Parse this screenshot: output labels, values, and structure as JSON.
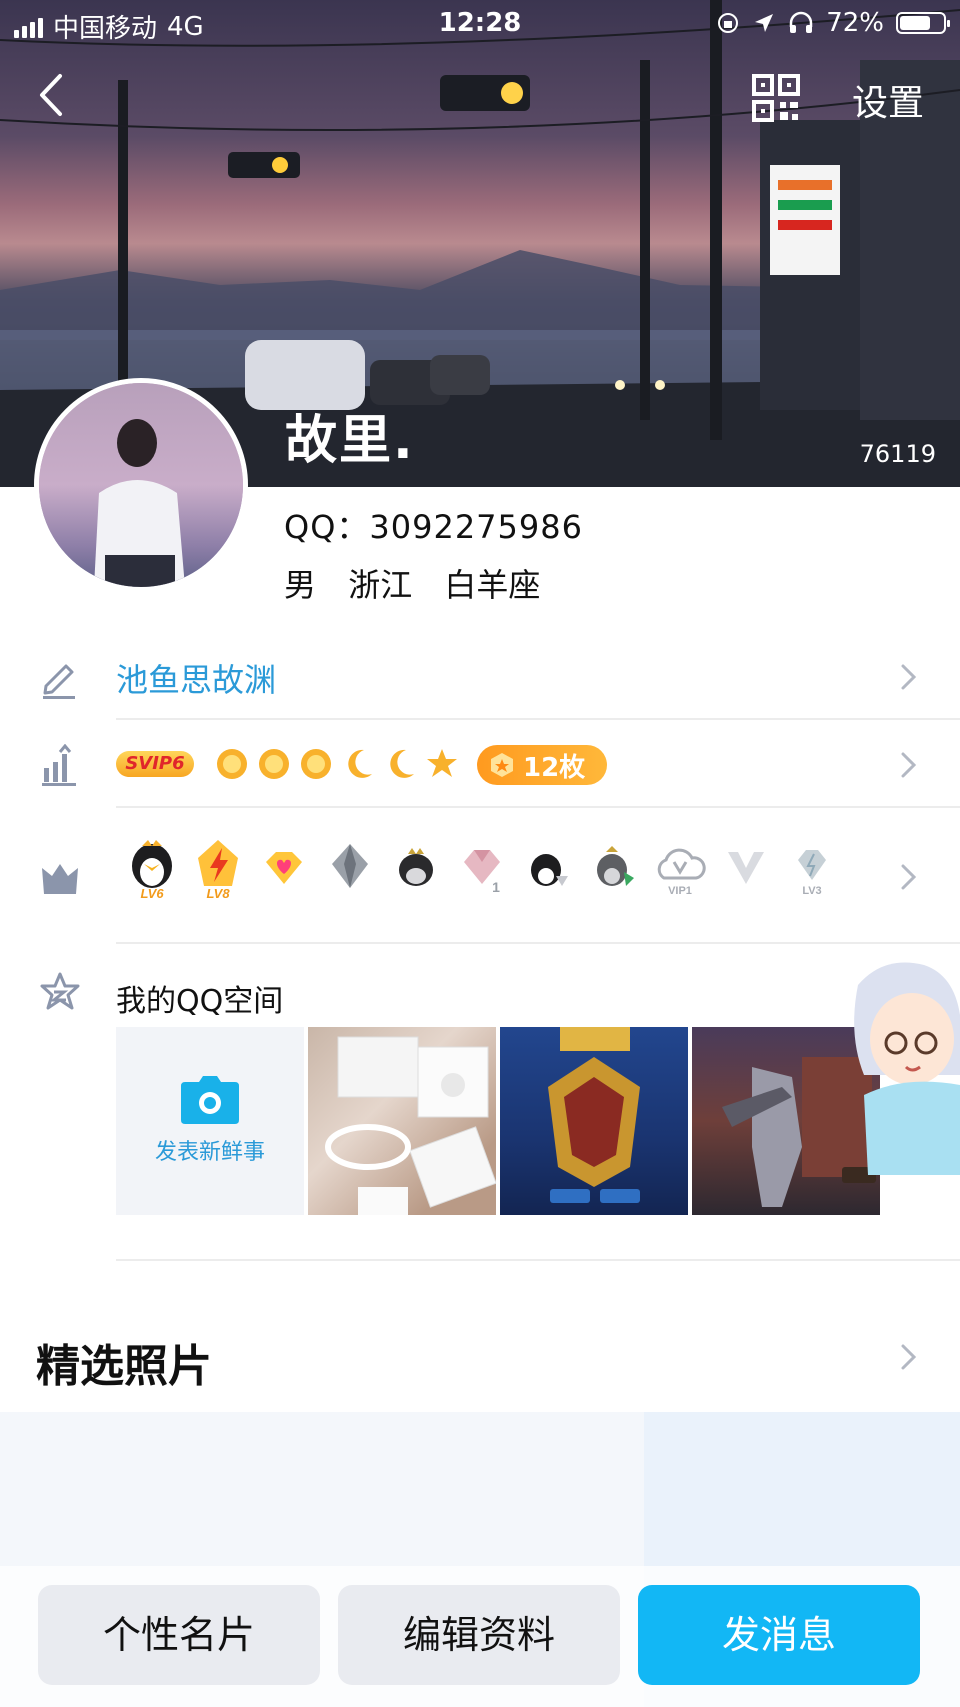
{
  "status_bar": {
    "carrier": "中国移动",
    "network": "4G",
    "time": "12:28",
    "battery_percent": "72%",
    "battery_level": 0.72
  },
  "nav": {
    "back_icon": "back-chevron-icon",
    "qr_icon": "qr-code-icon",
    "settings_label": "设置"
  },
  "profile": {
    "nickname": "故里.",
    "likes": "76119",
    "qq": "QQ：3092275986",
    "gender": "男",
    "region": "浙江",
    "zodiac": "白羊座"
  },
  "signature": "池鱼思故渊",
  "level_row": {
    "svip": "SVIP6",
    "icons": [
      "sun-icon",
      "sun-icon",
      "sun-icon",
      "moon-icon",
      "moon-icon",
      "star-icon"
    ],
    "badge_count": "12枚"
  },
  "privileges": [
    {
      "name": "qq-penguin-lv6-icon",
      "label": "LV6"
    },
    {
      "name": "lightning-lv8-icon",
      "label": "LV8"
    },
    {
      "name": "heart-diamond-icon",
      "label": ""
    },
    {
      "name": "silver-crystal-icon",
      "label": ""
    },
    {
      "name": "penguin-crown-icon",
      "label": ""
    },
    {
      "name": "pink-diamond-icon",
      "label": "1"
    },
    {
      "name": "penguin-game-icon",
      "label": ""
    },
    {
      "name": "penguin-music-icon",
      "label": ""
    },
    {
      "name": "vip1-cloud-icon",
      "label": "VIP1"
    },
    {
      "name": "v-badge-icon",
      "label": ""
    },
    {
      "name": "lv3-crystal-icon",
      "label": "LV3"
    }
  ],
  "qzone": {
    "title": "我的QQ空间",
    "new_post_label": "发表新鲜事"
  },
  "featured_photos": {
    "title": "精选照片"
  },
  "buttons": {
    "card": "个性名片",
    "edit": "编辑资料",
    "message": "发消息"
  },
  "colors": {
    "accent": "#12b7f5",
    "link_blue": "#2b9ad8",
    "badge_orange": "#ff9a1f"
  }
}
